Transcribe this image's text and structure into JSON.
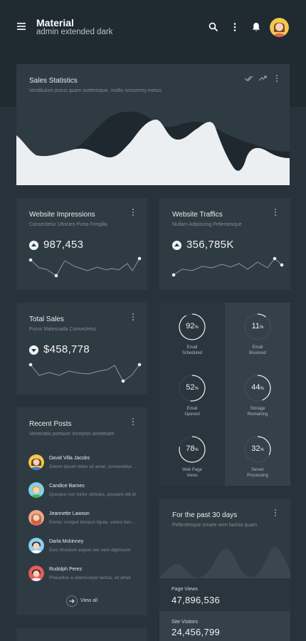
{
  "header": {
    "title": "Material",
    "subtitle": "admin extended dark"
  },
  "sales_statistics": {
    "title": "Sales Statistics",
    "subtitle": "Vestibulum purus quam scelerisque, mollis nonummy metus"
  },
  "impressions": {
    "title": "Website Impressions",
    "subtitle": "Consectetur Ultricies Porta Fringilla",
    "value": "987,453"
  },
  "traffics": {
    "title": "Website Traffics",
    "subtitle": "Nullam Adipiscing Pellentesque",
    "value": "356,785K"
  },
  "total_sales": {
    "title": "Total Sales",
    "subtitle": "Purus Malesuada Consectetur",
    "value": "$458,778"
  },
  "rings": [
    {
      "value": "92",
      "unit": "%",
      "label_1": "Email",
      "label_2": "Scheduled",
      "percent": 92
    },
    {
      "value": "11",
      "unit": "%",
      "label_1": "Email",
      "label_2": "Bounced",
      "percent": 11
    },
    {
      "value": "52",
      "unit": "%",
      "label_1": "Email",
      "label_2": "Opened",
      "percent": 52
    },
    {
      "value": "44",
      "unit": "%",
      "label_1": "Storage",
      "label_2": "Remaining",
      "percent": 44
    },
    {
      "value": "78",
      "unit": "%",
      "label_1": "Web Page",
      "label_2": "Views",
      "percent": 78
    },
    {
      "value": "32",
      "unit": "%",
      "label_1": "Server",
      "label_2": "Processing",
      "percent": 32
    }
  ],
  "recent_posts": {
    "title": "Recent Posts",
    "subtitle": "Venenatis portaum Inceptos ameteiam",
    "view_all": "View all",
    "posts": [
      {
        "name": "David Villa Jacobs",
        "text": "Sorem ipsum dolor sit amet, consectetur adipiscing"
      },
      {
        "name": "Candice Barnes",
        "text": "Quisque non tortor ultricies, posuere elit id"
      },
      {
        "name": "Jeannette Lawson",
        "text": "Donec congue tempus ligula, varius hendrerit"
      },
      {
        "name": "Darla Mckinney",
        "text": "Duis tincidunt augue nec sem dignissim"
      },
      {
        "name": "Rudolph Perez",
        "text": "Phasellus a ullamcorper lectus, sit amet"
      }
    ]
  },
  "past30": {
    "title": "For the past 30 days",
    "subtitle": "Pellentesque ornare sem lacinia quam",
    "page_views_label": "Page Views",
    "page_views_value": "47,896,536",
    "site_visitors_label": "Site Visitors",
    "site_visitors_value": "24,456,799"
  },
  "colors": {
    "background": "#27323a",
    "card": "#2f3b43",
    "accent_light": "#eceff1"
  },
  "icons": [
    "menu-icon",
    "search-icon",
    "more-vert-icon",
    "bell-icon",
    "avatar",
    "check-all-icon",
    "trending-up-icon",
    "arrow-up-icon",
    "arrow-down-icon",
    "arrow-right-icon"
  ]
}
